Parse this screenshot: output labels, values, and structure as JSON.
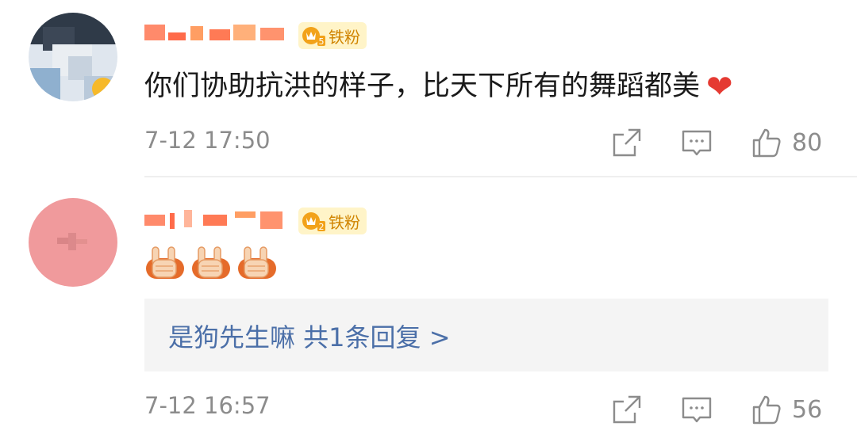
{
  "comments": [
    {
      "badge_label": "铁粉",
      "badge_level": "5",
      "text": "你们协助抗洪的样子，比天下所有的舞蹈都美",
      "reaction_emoji": "heart",
      "timestamp": "7-12 17:50",
      "like_count": "80"
    },
    {
      "badge_label": "铁粉",
      "badge_level": "2",
      "emoji": [
        "victory-hand-emoji",
        "victory-hand-emoji",
        "victory-hand-emoji"
      ],
      "reply_summary": "是狗先生嘛  共1条回复 >",
      "timestamp": "7-12 16:57",
      "like_count": "56"
    }
  ],
  "icons": [
    "share-icon",
    "comment-icon",
    "like-icon"
  ],
  "colors": {
    "accent_link": "#4b6fa8",
    "badge_gold": "#d08400",
    "heart": "#e53a32",
    "meta_gray": "#8c8c8c"
  }
}
